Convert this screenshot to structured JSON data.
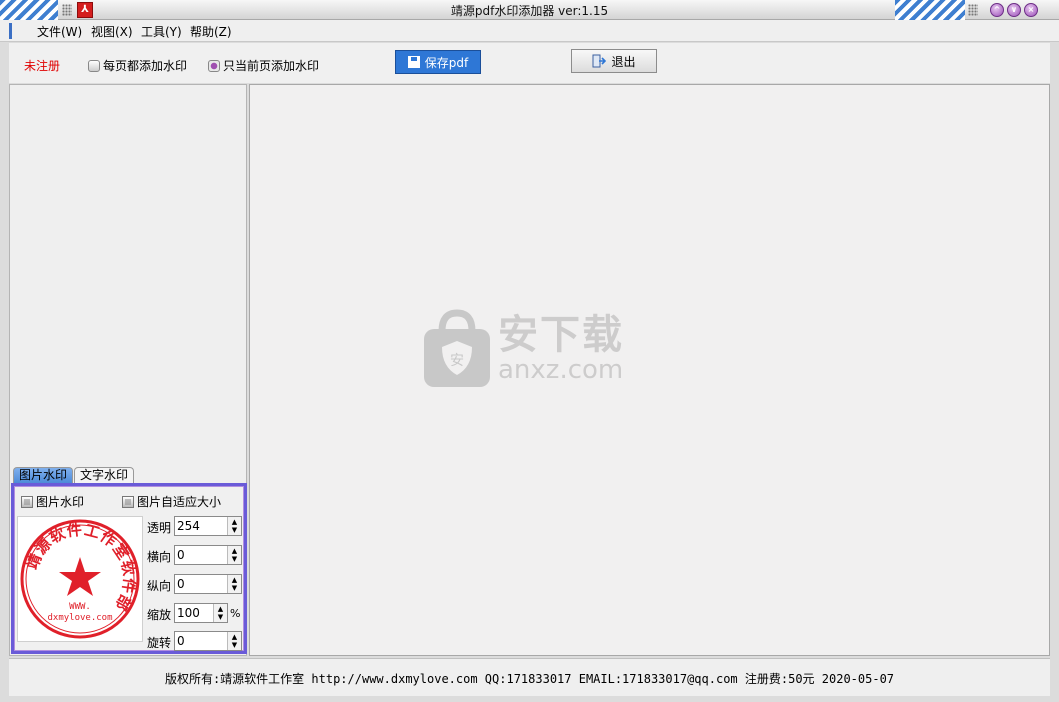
{
  "window": {
    "title": "靖源pdf水印添加器 ver:1.15",
    "controls": [
      "minimize-icon",
      "maximize-icon",
      "close-icon"
    ]
  },
  "menu": [
    {
      "label": "文件(W)"
    },
    {
      "label": "视图(X)"
    },
    {
      "label": "工具(Y)"
    },
    {
      "label": "帮助(Z)"
    }
  ],
  "toolbar": {
    "unregistered": "未注册",
    "option_every_page": "每页都添加水印",
    "option_current_page": "只当前页添加水印",
    "selected_option": "current_page",
    "save_label": "保存pdf",
    "exit_label": "退出"
  },
  "left_panel": {
    "tabs": [
      {
        "label": "图片水印",
        "active": true
      },
      {
        "label": "文字水印",
        "active": false
      }
    ],
    "image_watermark_checkbox": "图片水印",
    "autofit_checkbox": "图片自适应大小",
    "fields": [
      {
        "label": "透明",
        "value": "254"
      },
      {
        "label": "横向",
        "value": "0"
      },
      {
        "label": "纵向",
        "value": "0"
      },
      {
        "label": "缩放",
        "value": "100",
        "unit": "%"
      },
      {
        "label": "旋转",
        "value": "0"
      }
    ],
    "seal": {
      "ring_text": "靖源软件工作室软件部",
      "url_text": "WWW.",
      "domain_text": "dxmylove.com",
      "color": "#e0202a"
    }
  },
  "main_watermark": {
    "cn": "安下载",
    "en": "anxz.com"
  },
  "status": {
    "text": "版权所有:靖源软件工作室 http://www.dxmylove.com QQ:171833017 EMAIL:171833017@qq.com 注册费:50元 2020-05-07"
  },
  "colors": {
    "accent_blue": "#2e77d6",
    "unregistered_red": "#e00000",
    "panel_border": "#6a5bd8"
  }
}
